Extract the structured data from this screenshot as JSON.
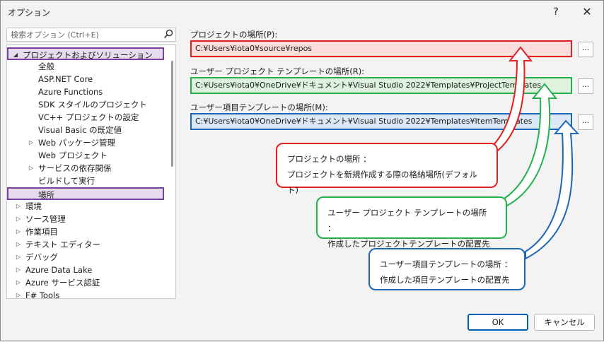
{
  "window": {
    "title": "オプション",
    "help_label": "?",
    "close_label": "✕"
  },
  "search": {
    "placeholder": "検索オプション (Ctrl+E)",
    "icon": "search-icon"
  },
  "tree": {
    "items": [
      {
        "label": "プロジェクトおよびソリューション",
        "expanded": true,
        "selected_outline": true
      },
      {
        "label": "全般"
      },
      {
        "label": "ASP.NET Core"
      },
      {
        "label": "Azure Functions"
      },
      {
        "label": "SDK スタイルのプロジェクト"
      },
      {
        "label": "VC++ プロジェクトの設定"
      },
      {
        "label": "Visual Basic の既定値"
      },
      {
        "label": "Web パッケージ管理",
        "collapsed": true
      },
      {
        "label": "Web プロジェクト"
      },
      {
        "label": "サービスの依存関係",
        "collapsed": true
      },
      {
        "label": "ビルドして実行"
      },
      {
        "label": "場所",
        "selected": true
      },
      {
        "label": "環境",
        "collapsed": true
      },
      {
        "label": "ソース管理",
        "collapsed": true
      },
      {
        "label": "作業項目",
        "collapsed": true
      },
      {
        "label": "テキスト エディター",
        "collapsed": true
      },
      {
        "label": "デバッグ",
        "collapsed": true
      },
      {
        "label": "Azure Data Lake",
        "collapsed": true
      },
      {
        "label": "Azure サービス認証",
        "collapsed": true
      },
      {
        "label": "F# Tools",
        "collapsed": true
      }
    ]
  },
  "locations": {
    "project": {
      "label": "プロジェクトの場所(P):",
      "value": "C:¥Users¥iota0¥source¥repos",
      "browse_label": "..."
    },
    "project_templates": {
      "label": "ユーザー プロジェクト テンプレートの場所(R):",
      "value": "C:¥Users¥iota0¥OneDrive¥ドキュメント¥Visual Studio 2022¥Templates¥ProjectTemplates",
      "browse_label": "..."
    },
    "item_templates": {
      "label": "ユーザー項目テンプレートの場所(M):",
      "value": "C:¥Users¥iota0¥OneDrive¥ドキュメント¥Visual Studio 2022¥Templates¥ItemTemplates",
      "browse_label": "..."
    }
  },
  "callouts": {
    "project": {
      "line1": "プロジェクトの場所 ：",
      "line2": "プロジェクトを新規作成する際の格納場所(デフォルト)"
    },
    "project_templates": {
      "line1": "ユーザー プロジェクト テンプレートの場所 ：",
      "line2": "作成したプロジェクトテンプレートの配置先"
    },
    "item_templates": {
      "line1": "ユーザー項目テンプレートの場所 ：",
      "line2": "作成した項目テンプレートの配置先"
    }
  },
  "colors": {
    "red": "#e32020",
    "green": "#22b24c",
    "blue": "#1b66b5",
    "purple": "#7a3fa0"
  },
  "buttons": {
    "ok": "OK",
    "cancel": "キャンセル"
  }
}
